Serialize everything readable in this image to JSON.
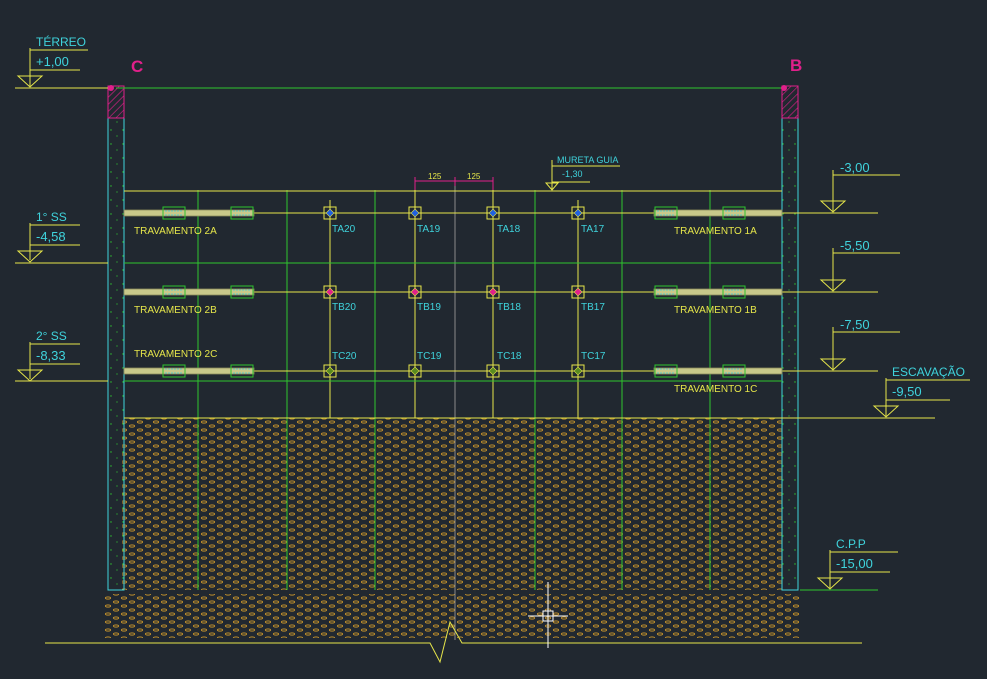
{
  "colors": {
    "background": "#212830",
    "level_line": "#e6e64a",
    "grid_line": "#2ec62e",
    "cyan_text": "#3fd3dc",
    "yellow_text": "#e6e64a",
    "magenta": "#e0208a",
    "soil": "#d29b2a",
    "beam": "#c8c88a"
  },
  "markers": {
    "left": "C",
    "right": "B"
  },
  "left_levels": [
    {
      "name": "TÉRREO",
      "value": "+1,00"
    },
    {
      "name": "1° SS",
      "value": "-4,58"
    },
    {
      "name": "2° SS",
      "value": "-8,33"
    }
  ],
  "right_levels": [
    {
      "name": "",
      "value": "-3,00"
    },
    {
      "name": "",
      "value": "-5,50"
    },
    {
      "name": "",
      "value": "-7,50"
    },
    {
      "name": "ESCAVAÇÃO",
      "value": "-9,50"
    },
    {
      "name": "C.P.P",
      "value": "-15,00"
    }
  ],
  "mureta": {
    "label": "MURETA GUIA",
    "value": "-1,30"
  },
  "dimension_125": [
    "125",
    "125"
  ],
  "bracings": {
    "left": [
      "TRAVAMENTO 2A",
      "TRAVAMENTO 2B",
      "TRAVAMENTO 2C"
    ],
    "right": [
      "TRAVAMENTO 1A",
      "TRAVAMENTO 1B",
      "TRAVAMENTO 1C"
    ]
  },
  "piles": {
    "row_a": [
      "TA20",
      "TA19",
      "TA18",
      "TA17"
    ],
    "row_b": [
      "TB20",
      "TB19",
      "TB18",
      "TB17"
    ],
    "row_c": [
      "TC20",
      "TC19",
      "TC18",
      "TC17"
    ]
  }
}
